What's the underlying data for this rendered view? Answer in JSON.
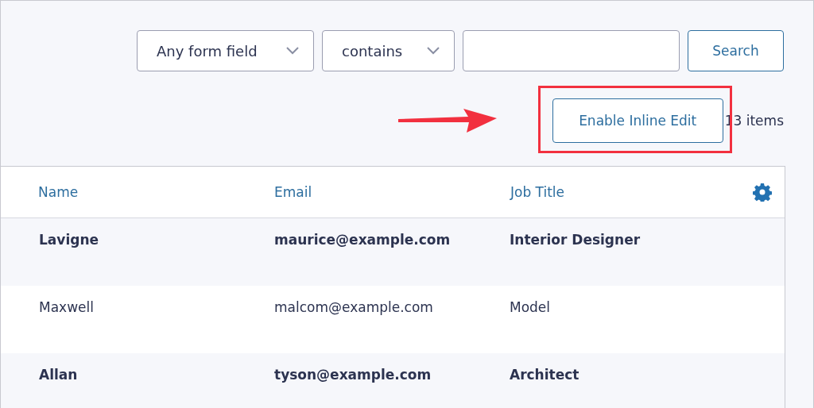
{
  "filters": {
    "field": "Any form field",
    "operator": "contains",
    "search_button": "Search"
  },
  "toolbar": {
    "inline_edit_button": "Enable Inline Edit",
    "item_count": "13 items",
    "highlighted": true
  },
  "table": {
    "columns": [
      "Name",
      "Email",
      "Job Title"
    ],
    "rows": [
      {
        "cells": [
          "Lavigne",
          "maurice@example.com",
          "Interior Designer"
        ],
        "unread": true
      },
      {
        "cells": [
          "Maxwell",
          "malcom@example.com",
          "Model"
        ],
        "unread": false
      },
      {
        "cells": [
          "Allan",
          "tyson@example.com",
          "Architect"
        ],
        "unread": true
      }
    ]
  }
}
